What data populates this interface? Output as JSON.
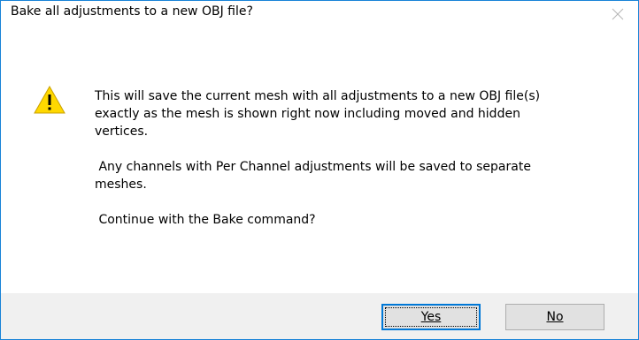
{
  "dialog": {
    "title": "Bake all adjustments to a new OBJ file?",
    "close_icon": "close-icon",
    "warning_icon": "warning-icon",
    "message": "This will save the current mesh with all adjustments to a new OBJ file(s)\nexactly as the mesh is shown right now including moved and hidden\nvertices.\n\n Any channels with Per Channel adjustments will be saved to separate\nmeshes.\n\n Continue with the Bake command?",
    "buttons": {
      "yes_label": "Yes",
      "no_label": "No"
    },
    "colors": {
      "border": "#1883d7",
      "footer_bg": "#f0f0f0",
      "warning_fill": "#ffd800",
      "default_button_border": "#0078d7"
    }
  }
}
